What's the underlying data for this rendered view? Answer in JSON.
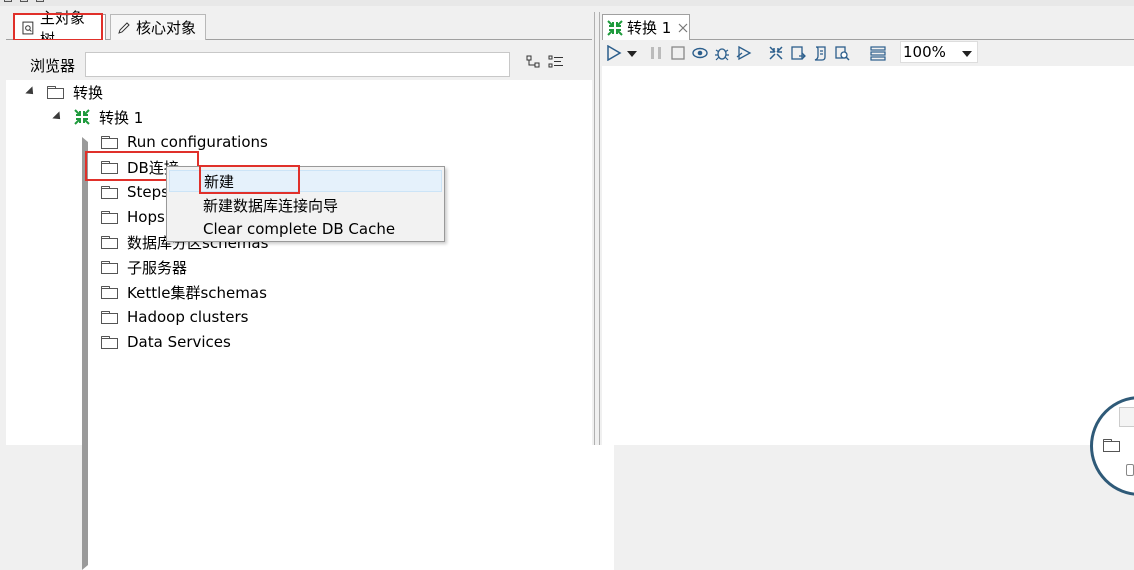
{
  "left_panel": {
    "tabs": [
      {
        "label": "主对象树",
        "icon": "tree-page-icon"
      },
      {
        "label": "核心对象",
        "icon": "pencil-icon"
      }
    ],
    "browser_label": "浏览器",
    "search_value": "",
    "tree": {
      "root": "转换",
      "transformation": "转换 1",
      "children": [
        "Run configurations",
        "DB连接",
        "Steps",
        "Hops",
        "数据库分区schemas",
        "子服务器",
        "Kettle集群schemas",
        "Hadoop clusters",
        "Data Services"
      ]
    }
  },
  "context_menu": {
    "items": [
      "新建",
      "新建数据库连接向导",
      "Clear complete DB Cache"
    ],
    "highlighted": "新建"
  },
  "right_panel": {
    "tab": {
      "label": "转换 1",
      "close_icon": "close-x-icon"
    },
    "toolbar": {
      "icons": [
        "run-icon",
        "run-dropdown-icon",
        "pause-icon",
        "stop-icon",
        "preview-icon",
        "debug-icon",
        "replay-icon",
        "verify-icon",
        "impact-icon",
        "sql-icon",
        "explore-db-icon",
        "grid-align-icon"
      ],
      "zoom": "100%"
    }
  },
  "colors": {
    "highlight_box": "#e0302a",
    "menu_hover": "#e5f1fb",
    "transformation_icon": "#1e9a3c"
  }
}
